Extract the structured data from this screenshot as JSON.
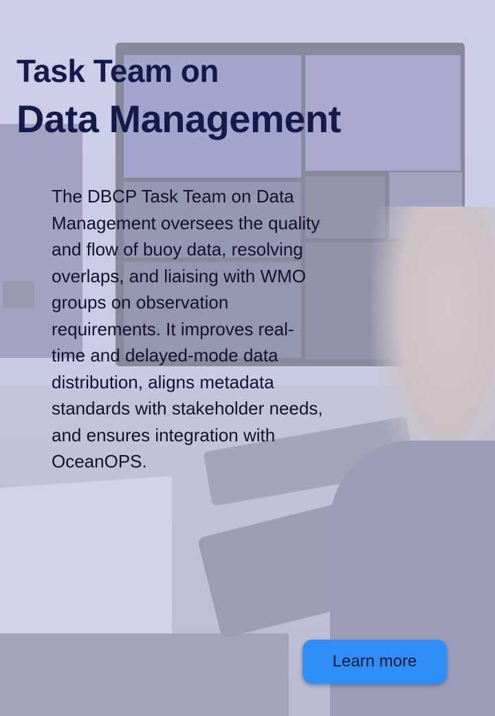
{
  "card": {
    "title_line1": "Task Team on",
    "title_line2": "Data Management",
    "description": "The DBCP Task Team on Data Management oversees the quality and flow of buoy data, resolving overlaps, and liaising with WMO groups on observation requirements. It improves real-time and delayed-mode data distribution, aligns metadata standards with stakeholder needs, and ensures integration with OceanOPS.",
    "cta_label": "Learn more"
  },
  "colors": {
    "title": "#141a4a",
    "body_text": "#10122e",
    "button": "#2f8ff7",
    "overlay": "#ced2eb"
  }
}
